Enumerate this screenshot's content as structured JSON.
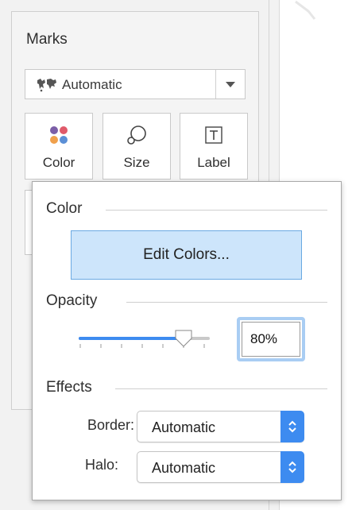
{
  "marks": {
    "title": "Marks",
    "mark_type": {
      "label": "Automatic",
      "icon": "map-marks-icon"
    },
    "buttons": [
      {
        "label": "Color",
        "icon": "color-dots-icon"
      },
      {
        "label": "Size",
        "icon": "size-icon"
      },
      {
        "label": "Label",
        "icon": "label-text-icon"
      }
    ]
  },
  "popup": {
    "color": {
      "title": "Color",
      "edit_button": "Edit Colors..."
    },
    "opacity": {
      "title": "Opacity",
      "value_text": "80%",
      "value": 80
    },
    "effects": {
      "title": "Effects",
      "border_label": "Border:",
      "border_value": "Automatic",
      "halo_label": "Halo:",
      "halo_value": "Automatic"
    }
  },
  "colors": {
    "accent": "#3d8bf0",
    "button_fill": "#cde5fb",
    "dots": [
      "#7b5ea7",
      "#e05a6a",
      "#f0a04b",
      "#5b8fd6"
    ]
  }
}
